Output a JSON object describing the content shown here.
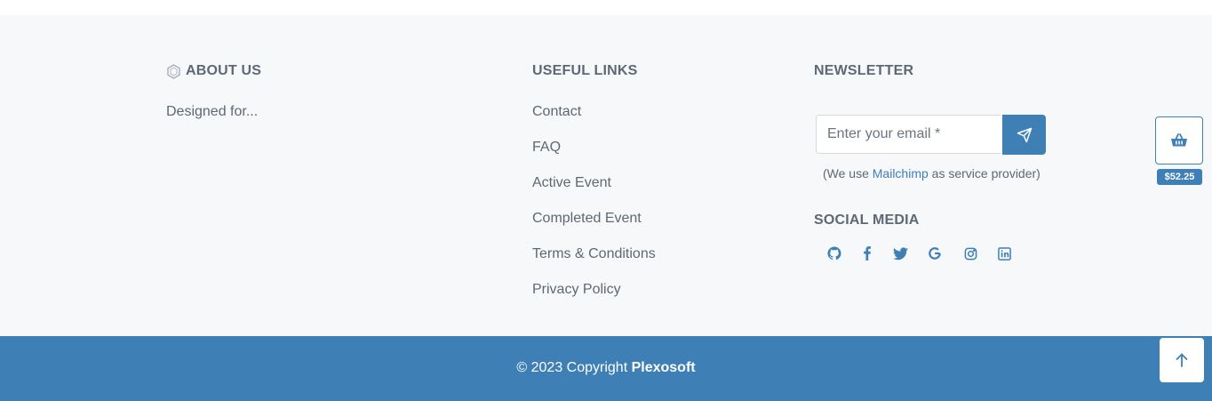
{
  "about": {
    "title": "ABOUT US",
    "text": "Designed for..."
  },
  "useful_links": {
    "title": "USEFUL LINKS",
    "items": [
      "Contact",
      "FAQ",
      "Active Event",
      "Completed Event",
      "Terms & Conditions",
      "Privacy Policy"
    ]
  },
  "newsletter": {
    "title": "NEWSLETTER",
    "email_placeholder": "Enter your email *",
    "note_prefix": "(We use ",
    "note_link": "Mailchimp",
    "note_suffix": " as service provider)"
  },
  "social": {
    "title": "SOCIAL MEDIA",
    "icons": [
      "github-icon",
      "facebook-icon",
      "twitter-icon",
      "google-icon",
      "instagram-icon",
      "linkedin-icon"
    ]
  },
  "cart": {
    "icon": "basket-icon",
    "amount": "$52.25"
  },
  "footer": {
    "copyright_text": "© 2023 Copyright ",
    "company": "Plexosoft"
  },
  "colors": {
    "accent": "#3e7fb6",
    "background": "#f7f8fa",
    "text": "#5d6874"
  }
}
